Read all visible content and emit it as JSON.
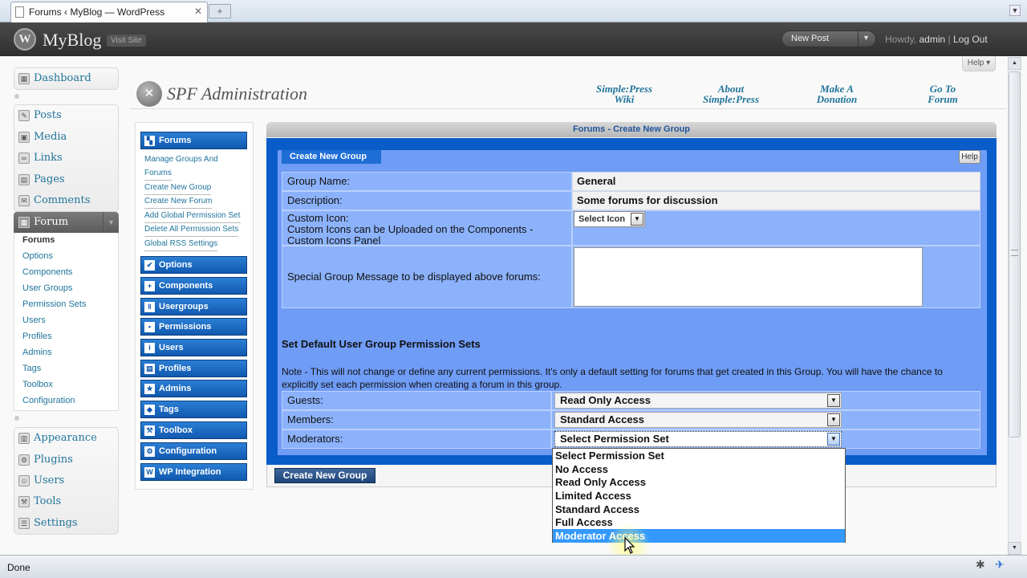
{
  "browser": {
    "tab_title": "Forums ‹ MyBlog — WordPress",
    "status": "Done"
  },
  "header": {
    "site_title": "MyBlog",
    "visit_site": "Visit Site",
    "new_post": "New Post",
    "howdy": "Howdy,",
    "user": "admin",
    "separator": "|",
    "logout": "Log Out",
    "help": "Help"
  },
  "wp_menu": {
    "dashboard": "Dashboard",
    "posts": "Posts",
    "media": "Media",
    "links": "Links",
    "pages": "Pages",
    "comments": "Comments",
    "forum": "Forum",
    "forum_sub": [
      "Forums",
      "Options",
      "Components",
      "User Groups",
      "Permission Sets",
      "Users",
      "Profiles",
      "Admins",
      "Tags",
      "Toolbox",
      "Configuration"
    ],
    "appearance": "Appearance",
    "plugins": "Plugins",
    "users": "Users",
    "tools": "Tools",
    "settings": "Settings"
  },
  "spf": {
    "title": "SPF Administration",
    "links": [
      {
        "line1": "Simple:Press",
        "line2": "Wiki"
      },
      {
        "line1": "About",
        "line2": "Simple:Press"
      },
      {
        "line1": "Make A",
        "line2": "Donation"
      },
      {
        "line1": "Go To",
        "line2": "Forum"
      }
    ],
    "menu": {
      "forums": "Forums",
      "forums_links": [
        "Manage Groups And",
        "Forums",
        "Create New Group",
        "Create New Forum",
        "Add Global Permission Set",
        "Delete All Permission Sets",
        "Global RSS Settings"
      ],
      "options": "Options",
      "components": "Components",
      "usergroups": "Usergroups",
      "permissions": "Permissions",
      "users": "Users",
      "profiles": "Profiles",
      "admins": "Admins",
      "tags": "Tags",
      "toolbox": "Toolbox",
      "configuration": "Configuration",
      "wp_integration": "WP Integration"
    }
  },
  "form": {
    "box_title": "Forums - Create New Group",
    "tab": "Create New Group",
    "help": "Help",
    "group_name_label": "Group Name:",
    "group_name_value": "General",
    "description_label": "Description:",
    "description_value": "Some forums for discussion",
    "custom_icon_label": "Custom Icon:",
    "custom_icon_note_1": "Custom Icons can be Uploaded on the Components -",
    "custom_icon_note_2": "Custom Icons Panel",
    "custom_icon_select": "Select Icon",
    "message_label": "Special Group Message to be displayed above forums:",
    "perm_title": "Set Default User Group Permission Sets",
    "perm_note": "Note - This will not change or define any current permissions. It's only a default setting for forums that get created in this Group. You will have the chance to explicitly set each permission when creating a forum in this group.",
    "guests_label": "Guests:",
    "guests_value": "Read Only Access",
    "members_label": "Members:",
    "members_value": "Standard Access",
    "moderators_label": "Moderators:",
    "moderators_value": "Select Permission Set",
    "submit": "Create New Group"
  },
  "dropdown": {
    "options": [
      "Select Permission Set",
      "No Access",
      "Read Only Access",
      "Limited Access",
      "Standard Access",
      "Full Access",
      "Moderator Access"
    ],
    "highlighted": "Moderator Access"
  },
  "colors": {
    "wp_header": "#333333",
    "spf_button": "#1159b0",
    "form_outer": "#0a5cc8",
    "form_inner": "#6f9cf5",
    "highlight": "#3399ff"
  }
}
